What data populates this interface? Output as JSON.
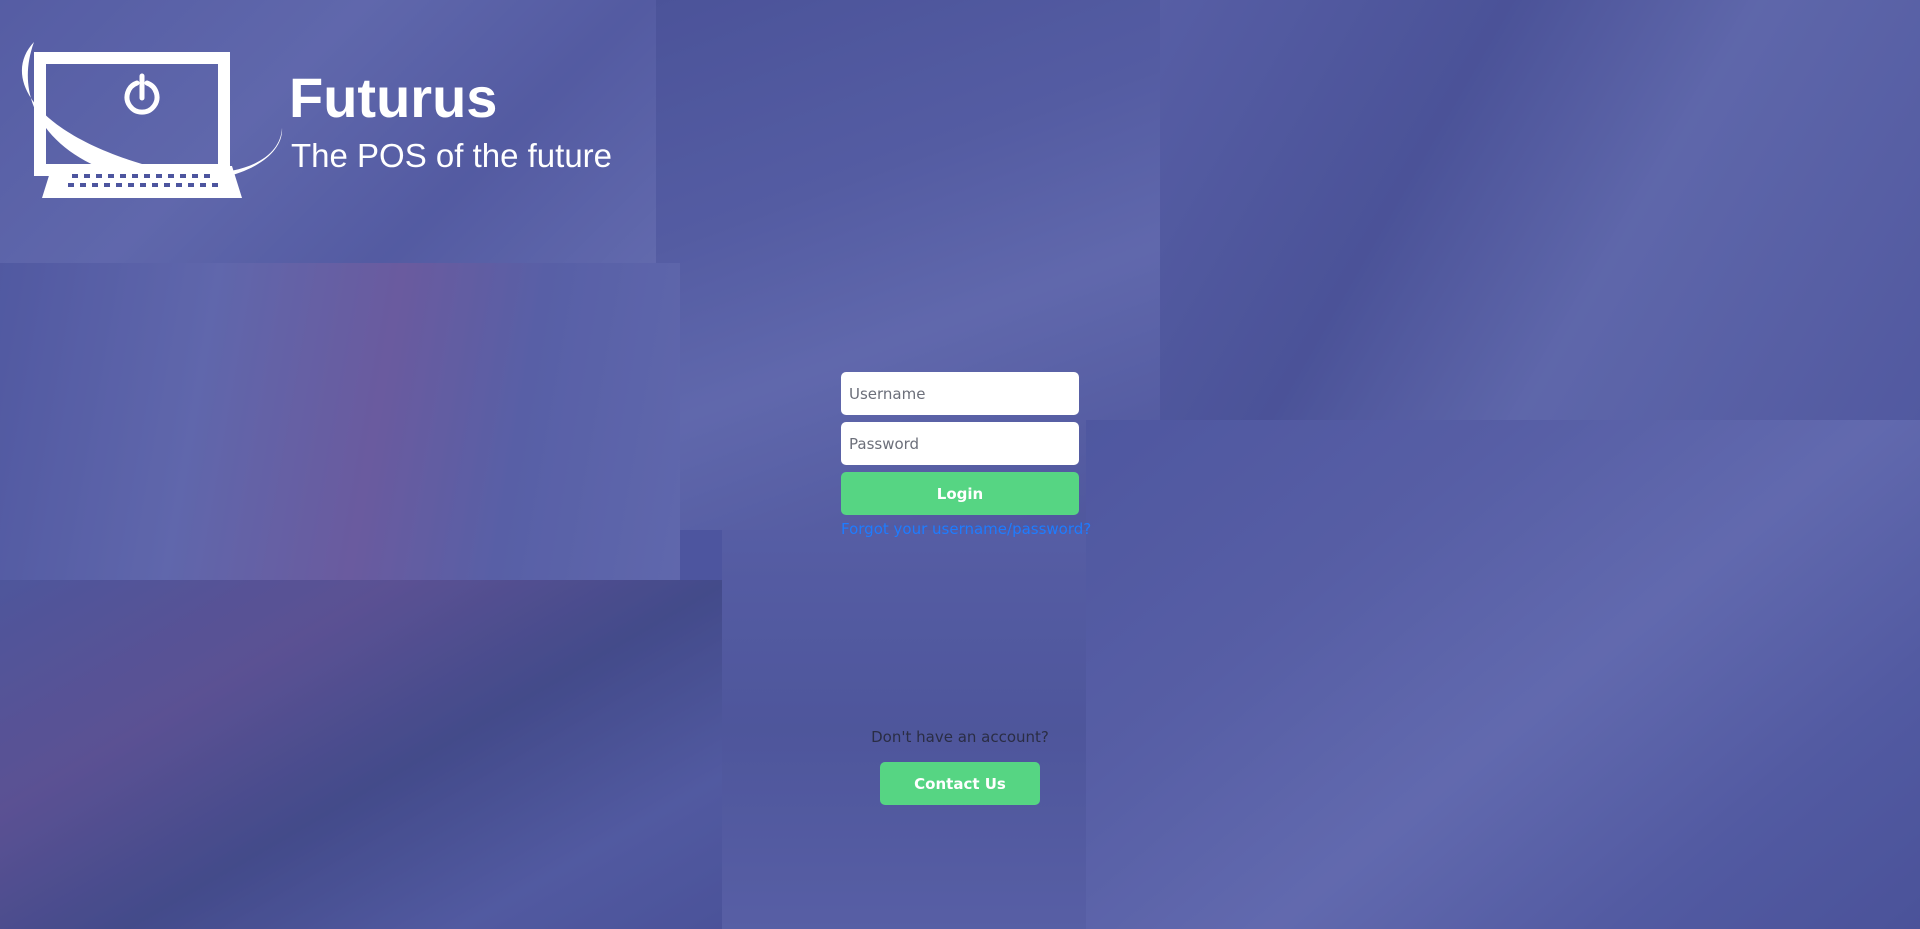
{
  "brand": {
    "name": "Futurus",
    "tagline": "The POS of the future"
  },
  "login": {
    "username_placeholder": "Username",
    "password_placeholder": "Password",
    "login_label": "Login",
    "forgot_label": "Forgot your username/password?"
  },
  "signup": {
    "prompt": "Don't have an account?",
    "contact_label": "Contact Us"
  },
  "colors": {
    "background": "#4d559f",
    "accent_green": "#56d583",
    "link_blue": "#1e7cff"
  },
  "icons": {
    "logo": "monitor-with-power-button-icon"
  }
}
